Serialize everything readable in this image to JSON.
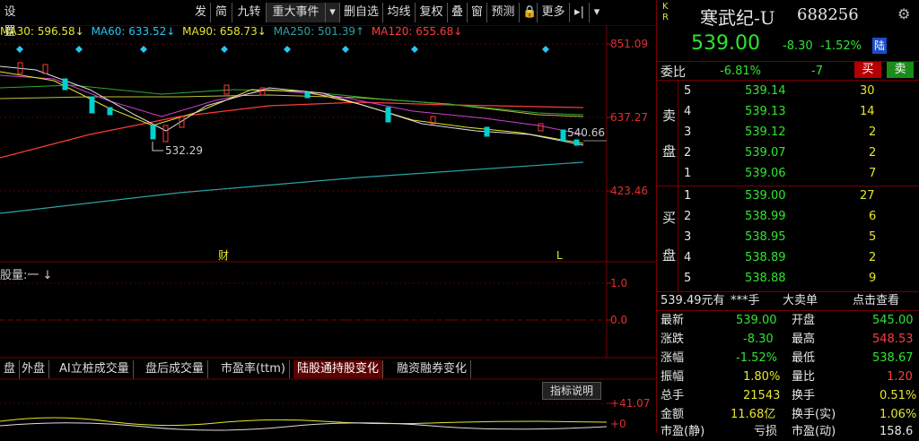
{
  "toolbar": {
    "settings_partial": "设置",
    "buttons": [
      "发",
      "简",
      "九转",
      "重大事件",
      "▾",
      "删自选",
      "均线",
      "复权",
      "叠",
      "窗",
      "预测",
      "🔒",
      "更多",
      "▸|",
      "▾"
    ]
  },
  "ma_legend": [
    {
      "label": "MA30: 596.58↓",
      "color": "#e6e62e"
    },
    {
      "label": "MA60: 633.52↓",
      "color": "#29c5f6"
    },
    {
      "label": "MA90: 658.73↓",
      "color": "#e6e62e"
    },
    {
      "label": "MA250: 501.39↑",
      "color": "#2aa3a3"
    },
    {
      "label": "MA120: 655.68↓",
      "color": "#ff3b3b"
    }
  ],
  "price_axis": [
    "851.09",
    "637.27",
    "423.46"
  ],
  "annotations": {
    "low_label": "532.29",
    "cur_label": "540.66",
    "fin_marker": "财",
    "l_marker": "L"
  },
  "indicator": {
    "title": "股量:一 ↓",
    "axis_top": "1.0",
    "axis_zero": "0.0"
  },
  "tabs": [
    "盘",
    "外盘",
    "AI立桩成交量",
    "盘后成交量",
    "市盈率(ttm)",
    "陆股通持股变化",
    "融资融券变化"
  ],
  "tab_active_index": 5,
  "lower_panel": {
    "help": "指标说明",
    "axis_top": "+41.07",
    "axis_bottom": "+0"
  },
  "quote": {
    "kr": "K R",
    "name": "寒武纪-U",
    "code": "688256",
    "price": "539.00",
    "change": "-8.30",
    "pct": "-1.52%",
    "tag": "陆",
    "weibi_label": "委比",
    "weibi_pct": "-6.81%",
    "weibi_diff": "-7",
    "buy_btn": "买",
    "sell_btn": "卖",
    "sell_label": [
      "卖",
      "盘"
    ],
    "buy_label": [
      "买",
      "盘"
    ],
    "asks": [
      {
        "lvl": "5",
        "price": "539.14",
        "vol": "30"
      },
      {
        "lvl": "4",
        "price": "539.13",
        "vol": "14"
      },
      {
        "lvl": "3",
        "price": "539.12",
        "vol": "2"
      },
      {
        "lvl": "2",
        "price": "539.07",
        "vol": "2"
      },
      {
        "lvl": "1",
        "price": "539.06",
        "vol": "7"
      }
    ],
    "bids": [
      {
        "lvl": "1",
        "price": "539.00",
        "vol": "27"
      },
      {
        "lvl": "2",
        "price": "538.99",
        "vol": "6"
      },
      {
        "lvl": "3",
        "price": "538.95",
        "vol": "5"
      },
      {
        "lvl": "4",
        "price": "538.89",
        "vol": "2"
      },
      {
        "lvl": "5",
        "price": "538.88",
        "vol": "9"
      }
    ],
    "big_order": {
      "price": "539.49元有",
      "vol": "***手",
      "type": "大卖单",
      "action": "点击查看"
    },
    "stats": [
      {
        "l1": "最新",
        "v1": "539.00",
        "c1": "green",
        "l2": "开盘",
        "v2": "545.00",
        "c2": "green"
      },
      {
        "l1": "涨跌",
        "v1": "-8.30",
        "c1": "green",
        "l2": "最高",
        "v2": "548.53",
        "c2": "red"
      },
      {
        "l1": "涨幅",
        "v1": "-1.52%",
        "c1": "green",
        "l2": "最低",
        "v2": "538.67",
        "c2": "green"
      },
      {
        "l1": "振幅",
        "v1": "1.80%",
        "c1": "yellow",
        "l2": "量比",
        "v2": "1.20",
        "c2": "red"
      },
      {
        "l1": "总手",
        "v1": "21543",
        "c1": "yellow",
        "l2": "换手",
        "v2": "0.51%",
        "c2": "yellow"
      },
      {
        "l1": "金额",
        "v1": "11.68亿",
        "c1": "yellow",
        "l2": "换手(实)",
        "v2": "1.06%",
        "c2": "yellow"
      },
      {
        "l1": "市盈(静)",
        "v1": "亏损",
        "c1": "white",
        "l2": "市盈(动)",
        "v2": "158.6",
        "c2": "white"
      }
    ]
  }
}
